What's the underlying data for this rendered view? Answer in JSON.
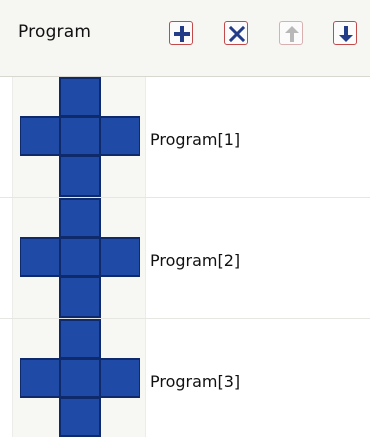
{
  "header": {
    "title": "Program",
    "buttons": [
      {
        "name": "add",
        "icon": "plus-icon",
        "enabled": true
      },
      {
        "name": "delete",
        "icon": "x-icon",
        "enabled": true
      },
      {
        "name": "move-up",
        "icon": "arrow-up-icon",
        "enabled": false
      },
      {
        "name": "move-down",
        "icon": "arrow-down-icon",
        "enabled": true
      }
    ]
  },
  "programs": [
    {
      "label": "Program[1]",
      "icon": "cross-program-icon"
    },
    {
      "label": "Program[2]",
      "icon": "cross-program-icon"
    },
    {
      "label": "Program[3]",
      "icon": "cross-program-icon"
    }
  ],
  "colors": {
    "icon_blue": "#1f4aa6",
    "icon_outline": "#0f2a6a",
    "button_border": "#c24a4a",
    "button_glyph": "#233c87",
    "header_bg": "#f6f6f3"
  }
}
